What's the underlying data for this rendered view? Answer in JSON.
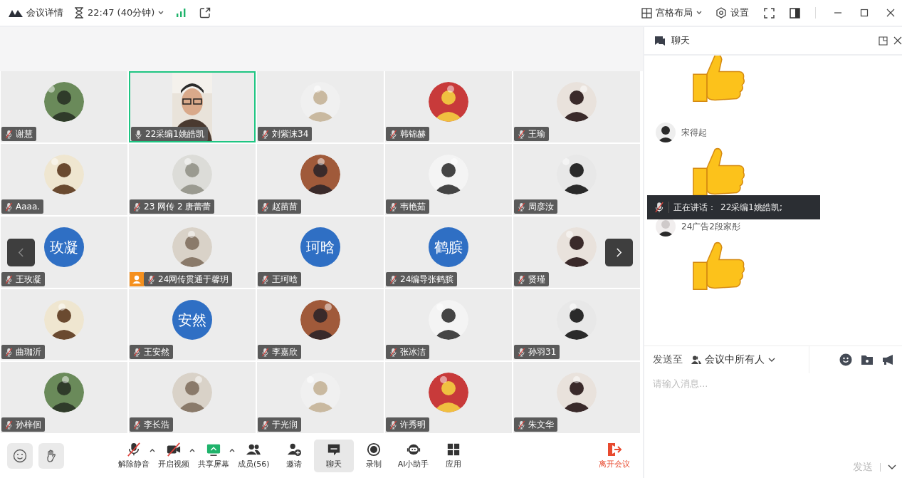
{
  "top_bar": {
    "title": "会议详情",
    "time": "22:47 (40分钟)",
    "layout": "宫格布局",
    "settings": "设置"
  },
  "tiles": [
    {
      "name": "谢慧",
      "muted": true,
      "host": false,
      "selected": false
    },
    {
      "name": "22采编1姚皓凯",
      "kind": "video",
      "muted": false,
      "host": false,
      "selected": true
    },
    {
      "name": "刘紫沫34",
      "muted": true,
      "host": false,
      "selected": false
    },
    {
      "name": "韩锦赫",
      "muted": true,
      "host": false,
      "selected": false
    },
    {
      "name": "王瑜",
      "muted": true,
      "host": false,
      "selected": false
    },
    {
      "name": "Aaaa.",
      "muted": true,
      "host": false,
      "selected": false
    },
    {
      "name": "23 网传 2 唐蕾蕾",
      "muted": true,
      "host": false,
      "selected": false
    },
    {
      "name": "赵苗苗",
      "muted": true,
      "host": false,
      "selected": false
    },
    {
      "name": "韦艳茹",
      "muted": true,
      "host": false,
      "selected": false
    },
    {
      "name": "周彦汝",
      "muted": true,
      "host": false,
      "selected": false
    },
    {
      "name": "王玫凝",
      "kind": "text",
      "avatar_text": "玫凝",
      "muted": true,
      "host": false,
      "selected": false
    },
    {
      "name": "24网传贯通于馨玥",
      "muted": true,
      "host": true,
      "selected": false
    },
    {
      "name": "王珂晗",
      "kind": "text",
      "avatar_text": "珂晗",
      "muted": true,
      "host": false,
      "selected": false
    },
    {
      "name": "24编导张鹤膑",
      "kind": "text",
      "avatar_text": "鹤膑",
      "muted": true,
      "host": false,
      "selected": false
    },
    {
      "name": "贤瑾",
      "muted": true,
      "host": false,
      "selected": false
    },
    {
      "name": "曲珈沂",
      "muted": true,
      "host": false,
      "selected": false
    },
    {
      "name": "王安然",
      "kind": "text",
      "avatar_text": "安然",
      "muted": true,
      "host": false,
      "selected": false
    },
    {
      "name": "李嘉欣",
      "muted": true,
      "host": false,
      "selected": false
    },
    {
      "name": "张冰洁",
      "muted": true,
      "host": false,
      "selected": false
    },
    {
      "name": "孙羽31",
      "muted": true,
      "host": false,
      "selected": false
    },
    {
      "name": "孙梓佪",
      "muted": true,
      "host": false,
      "selected": false
    },
    {
      "name": "李长浩",
      "muted": true,
      "host": false,
      "selected": false
    },
    {
      "name": "于光润",
      "muted": true,
      "host": false,
      "selected": false
    },
    {
      "name": "许秀明",
      "muted": true,
      "host": false,
      "selected": false
    },
    {
      "name": "朱文华",
      "muted": true,
      "host": false,
      "selected": false
    }
  ],
  "toolbar": [
    {
      "label": "解除静音",
      "off": true,
      "menu": true,
      "selected": false
    },
    {
      "label": "开启视频",
      "off": true,
      "menu": true,
      "selected": false
    },
    {
      "label": "共享屏幕",
      "off": false,
      "menu": true,
      "selected": false
    },
    {
      "label": "成员(56)",
      "off": false,
      "menu": false,
      "selected": false
    },
    {
      "label": "邀请",
      "off": false,
      "menu": false,
      "selected": false
    },
    {
      "label": "聊天",
      "off": false,
      "menu": false,
      "selected": true
    },
    {
      "label": "录制",
      "off": false,
      "menu": false,
      "selected": false
    },
    {
      "label": "AI小助手",
      "off": false,
      "menu": false,
      "selected": false
    },
    {
      "label": "应用",
      "off": false,
      "menu": false,
      "selected": false
    }
  ],
  "leave": "离开会议",
  "chat": {
    "title": "聊天",
    "messages": [
      {
        "kind": "sticker"
      },
      {
        "kind": "sticker",
        "sender": "宋得起"
      },
      {
        "kind": "sticker",
        "sender": "24广告2段家彤"
      }
    ],
    "speaking": {
      "label": "正在讲话：",
      "names": "22采编1姚皓凯;"
    },
    "send_to_label": "发送至",
    "recipient": "会议中所有人",
    "placeholder": "请输入消息...",
    "send": "发送"
  }
}
